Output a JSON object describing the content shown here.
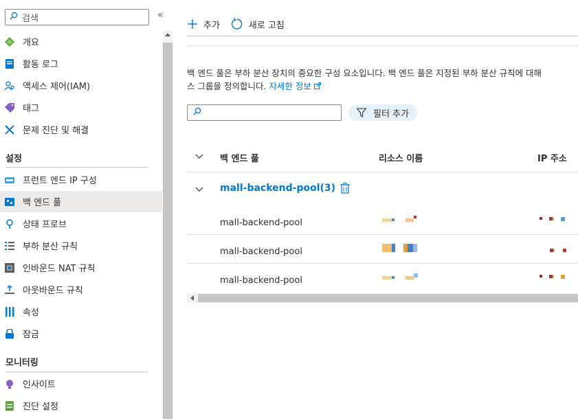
{
  "sidebar": {
    "search_placeholder": "검색",
    "collapse_glyph": "«",
    "items_top": [
      {
        "label": "개요",
        "icon": "overview-icon"
      },
      {
        "label": "활동 로그",
        "icon": "activity-log-icon"
      },
      {
        "label": "액세스 제어(IAM)",
        "icon": "access-control-icon"
      },
      {
        "label": "태그",
        "icon": "tag-icon"
      },
      {
        "label": "문제 진단 및 해결",
        "icon": "diagnose-icon"
      }
    ],
    "section_settings": "설정",
    "items_settings": [
      {
        "label": "프런트 엔드 IP 구성",
        "icon": "frontend-ip-icon"
      },
      {
        "label": "백 엔드 풀",
        "icon": "backend-pool-icon"
      },
      {
        "label": "상태 프로브",
        "icon": "health-probe-icon"
      },
      {
        "label": "부하 분산 규칙",
        "icon": "lb-rules-icon"
      },
      {
        "label": "인바운드 NAT 규칙",
        "icon": "inbound-nat-icon"
      },
      {
        "label": "아웃바운드 규칙",
        "icon": "outbound-rules-icon"
      },
      {
        "label": "속성",
        "icon": "properties-icon"
      },
      {
        "label": "잠금",
        "icon": "lock-icon"
      }
    ],
    "section_monitoring": "모니터링",
    "items_monitoring": [
      {
        "label": "인사이트",
        "icon": "insights-icon"
      },
      {
        "label": "진단 설정",
        "icon": "diagnostic-settings-icon"
      }
    ]
  },
  "toolbar": {
    "add_label": "추가",
    "refresh_label": "새로 고침"
  },
  "description": {
    "line1": "백 엔드 풀은 부하 분산 장치의 중요한 구성 요소입니다. 백 엔드 풀은 지정된 부하 분산 규칙에 대해",
    "line2_prefix": "스 그룹을 정의합니다. ",
    "link": "자세한 정보"
  },
  "filter": {
    "add_filter_label": "필터 추가"
  },
  "table": {
    "columns": [
      "백 엔드 풀",
      "리소스 이름",
      "IP 주소"
    ],
    "group_label": "mall-backend-pool(3)",
    "rows": [
      {
        "pool": "mall-backend-pool"
      },
      {
        "pool": "mall-backend-pool"
      },
      {
        "pool": "mall-backend-pool"
      }
    ]
  },
  "colors": {
    "accent": "#0078d4",
    "selected_bg": "#edebe9",
    "filter_pill_bg": "#e6f2fb"
  }
}
